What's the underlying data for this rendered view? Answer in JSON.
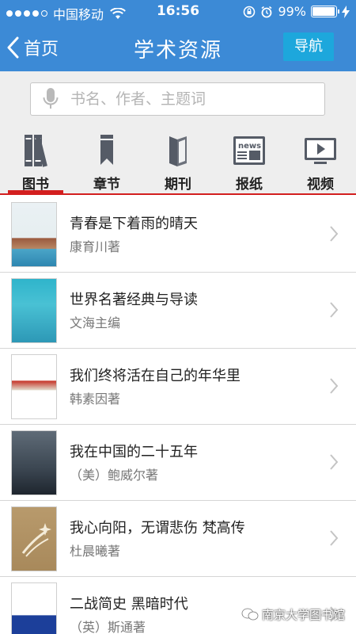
{
  "status_bar": {
    "carrier": "中国移动",
    "time": "16:56",
    "battery": "99%"
  },
  "nav": {
    "back_label": "首页",
    "title": "学术资源",
    "nav_button_label": "导航"
  },
  "search": {
    "placeholder": "书名、作者、主题词"
  },
  "tabs": [
    {
      "label": "图书",
      "icon": "books-icon",
      "active": true
    },
    {
      "label": "章节",
      "icon": "bookmark-icon",
      "active": false
    },
    {
      "label": "期刊",
      "icon": "journal-icon",
      "active": false
    },
    {
      "label": "报纸",
      "icon": "newspaper-icon",
      "active": false
    },
    {
      "label": "视频",
      "icon": "video-icon",
      "active": false
    }
  ],
  "books": [
    {
      "title": "青春是下着雨的晴天",
      "author": "康育川著"
    },
    {
      "title": "世界名著经典与导读",
      "author": "文海主编"
    },
    {
      "title": "我们终将活在自己的年华里",
      "author": "韩素因著"
    },
    {
      "title": "我在中国的二十五年",
      "author": "（美）鲍威尔著"
    },
    {
      "title": "我心向阳，无谓悲伤 梵高传",
      "author": "杜晨曦著"
    },
    {
      "title": "二战简史 黑暗时代",
      "author": "（英）斯通著"
    }
  ],
  "watermark": "南京大学图书馆",
  "colors": {
    "header_blue": "#3c8ad6",
    "nav_button": "#1da7dc",
    "active_red": "#d31f1f"
  }
}
